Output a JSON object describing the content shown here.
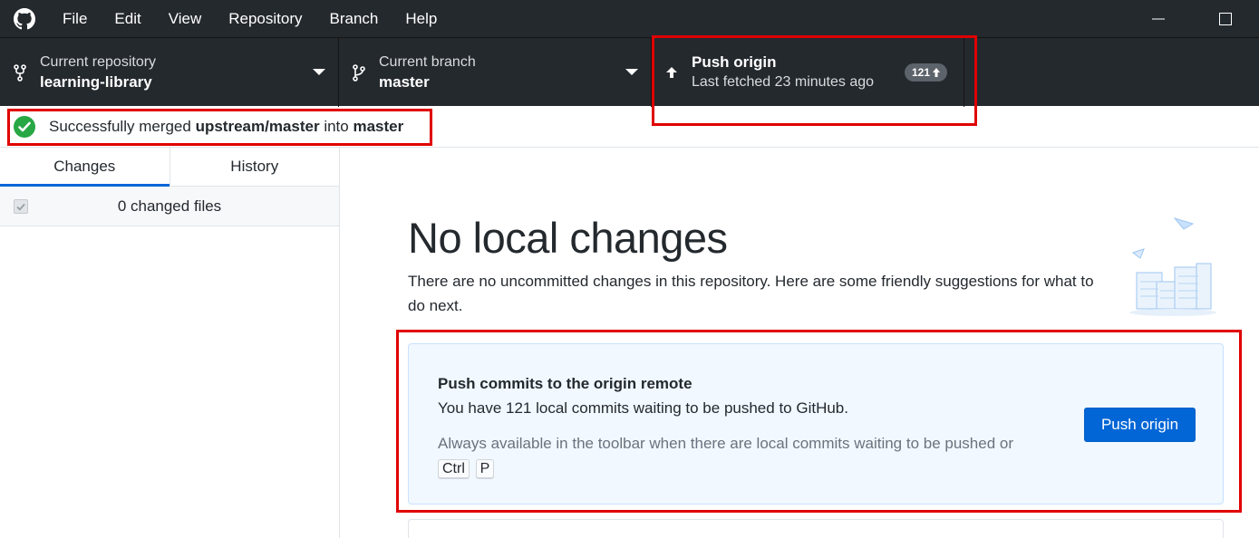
{
  "menu": {
    "items": [
      "File",
      "Edit",
      "View",
      "Repository",
      "Branch",
      "Help"
    ]
  },
  "toolbar": {
    "repository": {
      "description": "Current repository",
      "title": "learning-library"
    },
    "branch": {
      "description": "Current branch",
      "title": "master"
    },
    "push": {
      "title": "Push origin",
      "description": "Last fetched 23 minutes ago",
      "badge_count": "121"
    }
  },
  "banner": {
    "prefix": "Successfully merged ",
    "source_branch": "upstream/master",
    "middle": " into ",
    "target_branch": "master"
  },
  "sidebar": {
    "tabs": [
      {
        "label": "Changes",
        "selected": true
      },
      {
        "label": "History",
        "selected": false
      }
    ],
    "changed_files_label": "0 changed files"
  },
  "main": {
    "headline": "No local changes",
    "subtext": "There are no uncommitted changes in this repository. Here are some friendly suggestions for what to do next.",
    "suggestion": {
      "title": "Push commits to the origin remote",
      "description": "You have 121 local commits waiting to be pushed to GitHub.",
      "hint": "Always available in the toolbar when there are local commits waiting to be pushed or",
      "shortcut_keys": [
        "Ctrl",
        "P"
      ],
      "button_label": "Push origin"
    }
  },
  "colors": {
    "chrome": "#24292e",
    "accent_blue": "#0366d6",
    "success_green": "#28a745",
    "highlight_red": "#e00000",
    "suggestion_bg": "#f1f8ff"
  }
}
